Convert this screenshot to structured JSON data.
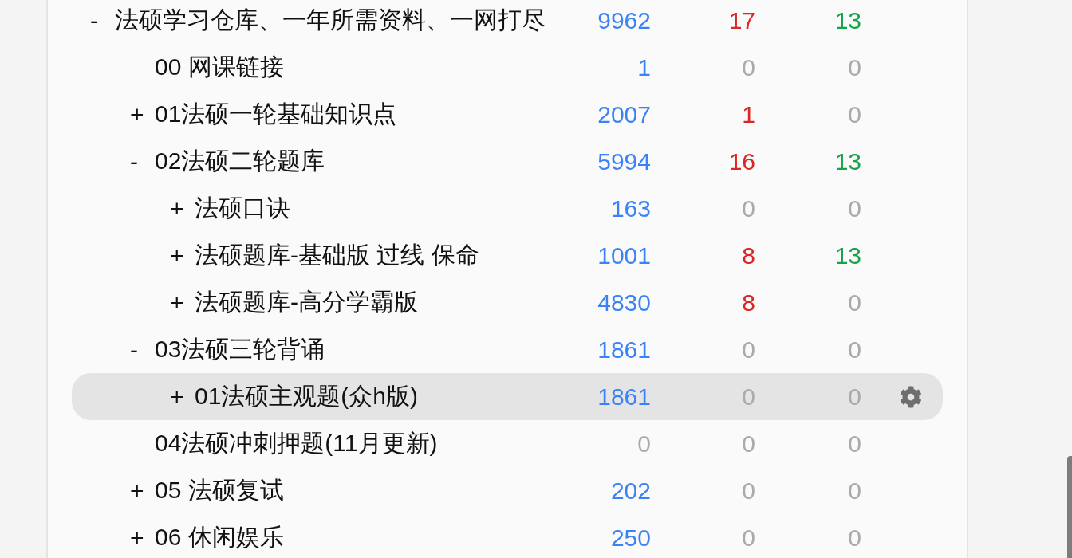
{
  "decks": [
    {
      "toggle": "-",
      "name": "法硕学习仓库、一年所需资料、一网打尽",
      "selected": false,
      "counts": [
        {
          "text": "9962",
          "dimmed": false
        },
        {
          "text": "17",
          "dimmed": false
        },
        {
          "text": "13",
          "dimmed": false
        }
      ],
      "children": [
        {
          "name": "00 网课链接",
          "selected": false,
          "counts": [
            {
              "text": "1",
              "dimmed": false
            },
            {
              "text": "0",
              "dimmed": true
            },
            {
              "text": "0",
              "dimmed": true
            }
          ]
        },
        {
          "toggle": "+",
          "name": "01法硕一轮基础知识点",
          "selected": false,
          "counts": [
            {
              "text": "2007",
              "dimmed": false
            },
            {
              "text": "1",
              "dimmed": false
            },
            {
              "text": "0",
              "dimmed": true
            }
          ]
        },
        {
          "toggle": "-",
          "name": "02法硕二轮题库",
          "selected": false,
          "counts": [
            {
              "text": "5994",
              "dimmed": false
            },
            {
              "text": "16",
              "dimmed": false
            },
            {
              "text": "13",
              "dimmed": false
            }
          ],
          "children": [
            {
              "toggle": "+",
              "name": "法硕口诀",
              "selected": false,
              "counts": [
                {
                  "text": "163",
                  "dimmed": false
                },
                {
                  "text": "0",
                  "dimmed": true
                },
                {
                  "text": "0",
                  "dimmed": true
                }
              ]
            },
            {
              "toggle": "+",
              "name": "法硕题库-基础版 过线 保命",
              "selected": false,
              "counts": [
                {
                  "text": "1001",
                  "dimmed": false
                },
                {
                  "text": "8",
                  "dimmed": false
                },
                {
                  "text": "13",
                  "dimmed": false
                }
              ]
            },
            {
              "toggle": "+",
              "name": "法硕题库-高分学霸版",
              "selected": false,
              "counts": [
                {
                  "text": "4830",
                  "dimmed": false
                },
                {
                  "text": "8",
                  "dimmed": false
                },
                {
                  "text": "0",
                  "dimmed": true
                }
              ]
            }
          ]
        },
        {
          "toggle": "-",
          "name": "03法硕三轮背诵",
          "selected": false,
          "counts": [
            {
              "text": "1861",
              "dimmed": false
            },
            {
              "text": "0",
              "dimmed": true
            },
            {
              "text": "0",
              "dimmed": true
            }
          ],
          "children": [
            {
              "toggle": "+",
              "name": "01法硕主观题(众h版)",
              "selected": true,
              "counts": [
                {
                  "text": "1861",
                  "dimmed": false
                },
                {
                  "text": "0",
                  "dimmed": true
                },
                {
                  "text": "0",
                  "dimmed": true
                }
              ]
            }
          ]
        },
        {
          "name": "04法硕冲刺押题(11月更新)",
          "selected": false,
          "counts": [
            {
              "text": "0",
              "dimmed": true
            },
            {
              "text": "0",
              "dimmed": true
            },
            {
              "text": "0",
              "dimmed": true
            }
          ]
        },
        {
          "toggle": "+",
          "name": "05 法硕复试",
          "selected": false,
          "counts": [
            {
              "text": "202",
              "dimmed": false
            },
            {
              "text": "0",
              "dimmed": true
            },
            {
              "text": "0",
              "dimmed": true
            }
          ]
        },
        {
          "toggle": "+",
          "name": "06 休闲娱乐",
          "selected": false,
          "counts": [
            {
              "text": "250",
              "dimmed": false
            },
            {
              "text": "0",
              "dimmed": true
            },
            {
              "text": "0",
              "dimmed": true
            }
          ]
        }
      ]
    }
  ]
}
